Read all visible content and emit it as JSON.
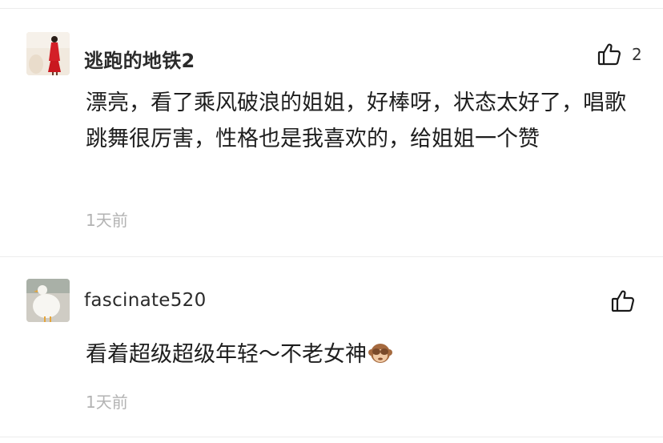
{
  "comments": [
    {
      "username": "逃跑的地铁2",
      "avatar_icon": "avatar-woman-red-dress",
      "like_icon": "thumbs-up-outline-icon",
      "like_count": "2",
      "text": "漂亮，看了乘风破浪的姐姐，好棒呀，状态太好了，唱歌跳舞很厉害，性格也是我喜欢的，给姐姐一个赞",
      "time": "1天前"
    },
    {
      "username": "fascinate520",
      "avatar_icon": "avatar-white-duck",
      "like_icon": "thumbs-up-outline-icon",
      "like_count": "",
      "text": "看着超级超级年轻～不老女神",
      "emoji": "see-no-evil-monkey-emoji",
      "time": "1天前"
    }
  ]
}
